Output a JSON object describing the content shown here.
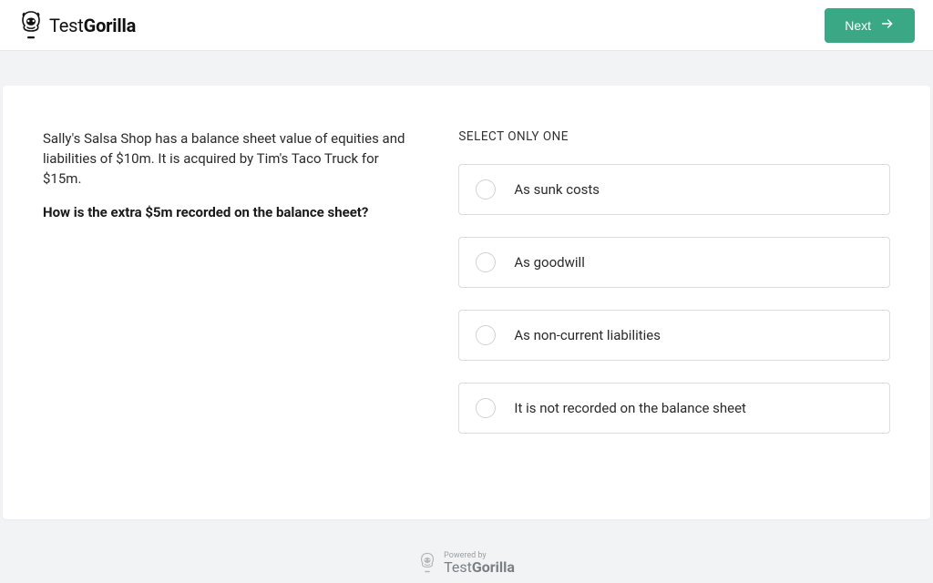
{
  "header": {
    "brand_light": "Test",
    "brand_bold": "Gorilla",
    "next_label": "Next"
  },
  "question": {
    "context": "Sally's Salsa Shop has a balance sheet value of equities and liabilities of $10m. It is acquired by Tim's Taco Truck for $15m.",
    "prompt": "How is the extra $5m recorded on the balance sheet?"
  },
  "answers": {
    "instruction": "SELECT ONLY ONE",
    "options": [
      "As sunk costs",
      "As goodwill",
      "As non-current liabilities",
      "It is not recorded on the balance sheet"
    ]
  },
  "footer": {
    "powered": "Powered by",
    "brand_light": "Test",
    "brand_bold": "Gorilla"
  }
}
